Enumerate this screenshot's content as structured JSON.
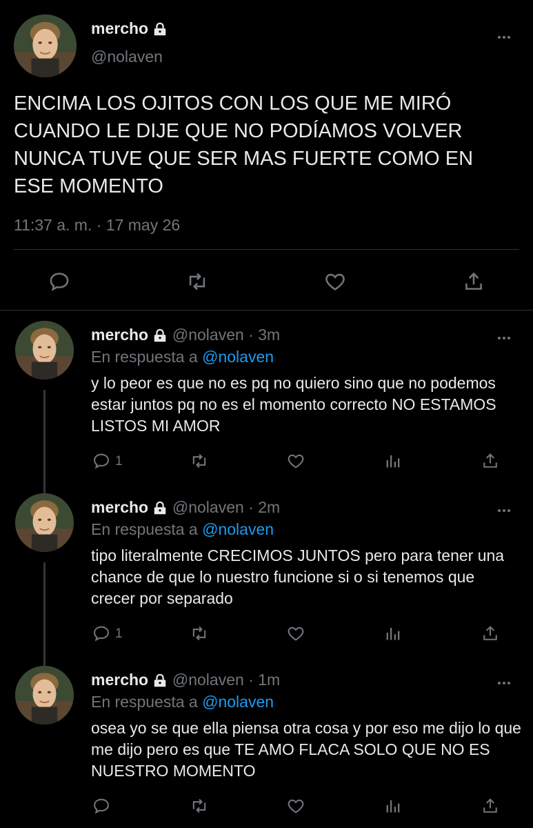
{
  "main_tweet": {
    "display_name": "mercho",
    "handle": "@nolaven",
    "text": "ENCIMA LOS OJITOS CON LOS QUE ME MIRÓ CUANDO LE DIJE QUE NO PODÍAMOS VOLVER NUNCA TUVE QUE SER MAS FUERTE COMO EN ESE MOMENTO",
    "timestamp": "11:37 a. m. · 17 may 26"
  },
  "replies": [
    {
      "display_name": "mercho",
      "meta": "@nolaven · 3m",
      "reply_prefix": "En respuesta a",
      "reply_to": "@nolaven",
      "text": "y lo peor es que no es pq no quiero sino que no podemos estar juntos pq no es el momento correcto NO ESTAMOS LISTOS MI AMOR",
      "reply_count": "1"
    },
    {
      "display_name": "mercho",
      "meta": "@nolaven · 2m",
      "reply_prefix": "En respuesta a",
      "reply_to": "@nolaven",
      "text": "tipo literalmente CRECIMOS JUNTOS pero para tener una chance de que lo nuestro funcione si o si tenemos que crecer por separado",
      "reply_count": "1"
    },
    {
      "display_name": "mercho",
      "meta": "@nolaven · 1m",
      "reply_prefix": "En respuesta a",
      "reply_to": "@nolaven",
      "text": "osea yo se que ella piensa otra cosa y por eso me dijo lo que me dijo pero es que TE AMO FLACA SOLO QUE NO ES NUESTRO MOMENTO",
      "reply_count": ""
    }
  ],
  "colors": {
    "background": "#000000",
    "text": "#e7e9ea",
    "muted": "#71767b",
    "link": "#1d9bf0",
    "divider": "#2f3336"
  },
  "icons": [
    "lock-icon",
    "more-icon",
    "reply-icon",
    "retweet-icon",
    "like-icon",
    "share-icon",
    "analytics-icon"
  ]
}
